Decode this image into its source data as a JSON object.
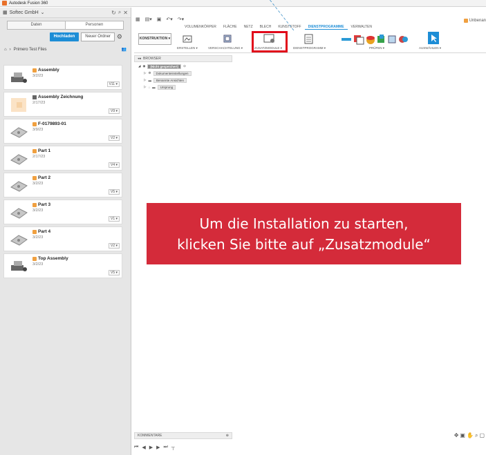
{
  "app": {
    "title": "Autodesk Fusion 360",
    "doc_title": "Unbenan"
  },
  "datapanel": {
    "team": "Softec GmbH",
    "tab_data": "Daten",
    "tab_people": "Personen",
    "upload": "Hochladen",
    "new_folder": "Neuer Ordner",
    "project": "Primero Test Files",
    "files": [
      {
        "name": "Assembly",
        "date": "3/2/23",
        "version": "V11 ▾",
        "type": "assembly"
      },
      {
        "name": "Assembly Zeichnung",
        "date": "2/17/23",
        "version": "V9 ▾",
        "type": "drawing"
      },
      {
        "name": "F-0179893-01",
        "date": "3/9/23",
        "version": "V2 ▾",
        "type": "part"
      },
      {
        "name": "Part 1",
        "date": "2/17/23",
        "version": "V4 ▾",
        "type": "part"
      },
      {
        "name": "Part 2",
        "date": "3/2/23",
        "version": "V5 ▾",
        "type": "part"
      },
      {
        "name": "Part 3",
        "date": "3/2/23",
        "version": "V1 ▾",
        "type": "part"
      },
      {
        "name": "Part 4",
        "date": "3/2/23",
        "version": "V2 ▾",
        "type": "part"
      },
      {
        "name": "Top Assembly",
        "date": "3/2/23",
        "version": "V5 ▾",
        "type": "assembly"
      }
    ]
  },
  "toolbar": {
    "tabs": [
      "VOLUMENKÖRPER",
      "FLÄCHE",
      "NETZ",
      "BLECH",
      "KUNSTSTOFF",
      "DIENSTPROGRAMME",
      "VERWALTEN"
    ],
    "workspace": "KONSTRUKTION ▾",
    "groups": [
      "ERSTELLEN ▾",
      "VERSCHACHTELUNG ▾",
      "ZUSATZMODULE ▾",
      "DIENSTPROGRAMM ▾",
      "PRÜFEN ▾",
      "AUSWÄHLEN ▾"
    ]
  },
  "browser": {
    "title": "BROWSER",
    "root": "(Nicht gespeichert)",
    "items": [
      "Dokumenteinstellungen",
      "Benannte Ansichten",
      "Ursprung"
    ]
  },
  "banner": {
    "line1": "Um die Installation zu starten,",
    "line2": "klicken Sie bitte auf „Zusatzmodule“"
  },
  "comments": "KOMMENTARE"
}
